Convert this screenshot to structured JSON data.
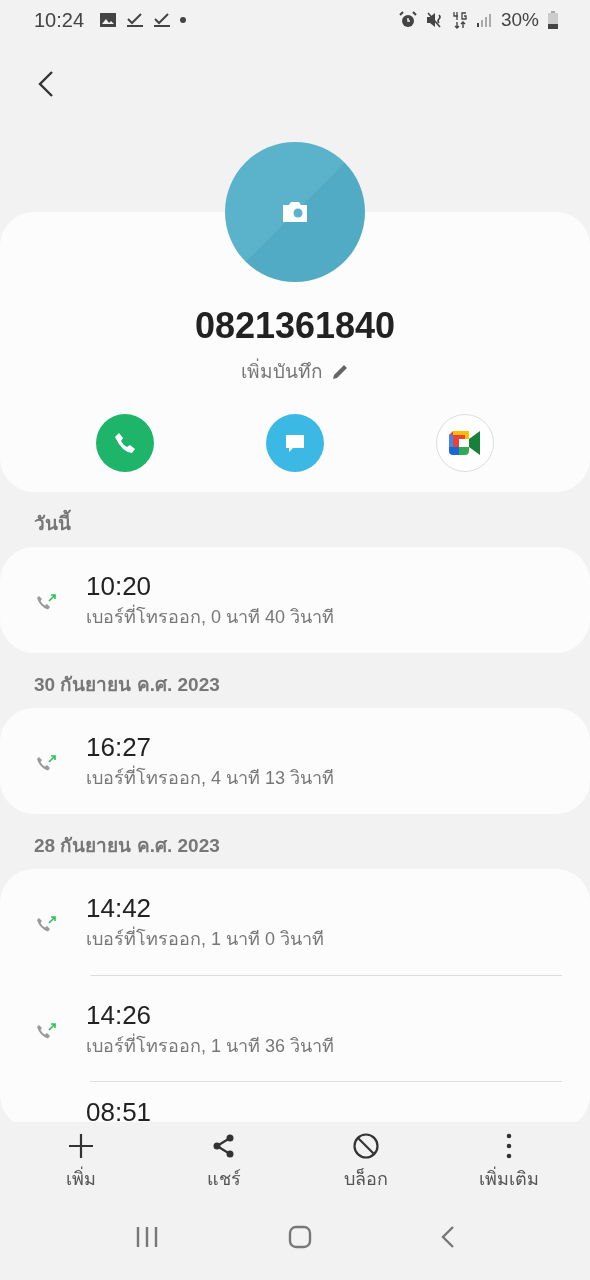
{
  "status_bar": {
    "time": "10:24",
    "battery": "30%"
  },
  "contact": {
    "number": "0821361840",
    "note_link": "เพิ่มบันทึก"
  },
  "history": [
    {
      "date": "วันนี้",
      "calls": [
        {
          "time": "10:20",
          "detail": "เบอร์ที่โทรออก, 0 นาที 40 วินาที"
        }
      ]
    },
    {
      "date": "30 กันยายน ค.ศ. 2023",
      "calls": [
        {
          "time": "16:27",
          "detail": "เบอร์ที่โทรออก, 4 นาที 13 วินาที"
        }
      ]
    },
    {
      "date": "28 กันยายน ค.ศ. 2023",
      "calls": [
        {
          "time": "14:42",
          "detail": "เบอร์ที่โทรออก, 1 นาที 0 วินาที"
        },
        {
          "time": "14:26",
          "detail": "เบอร์ที่โทรออก, 1 นาที 36 วินาที"
        },
        {
          "time": "08:51"
        }
      ]
    }
  ],
  "bottom_actions": [
    {
      "kind": "add",
      "label": "เพิ่ม"
    },
    {
      "kind": "share",
      "label": "แชร์"
    },
    {
      "kind": "block",
      "label": "บล็อก"
    },
    {
      "kind": "more",
      "label": "เพิ่มเติม"
    }
  ]
}
